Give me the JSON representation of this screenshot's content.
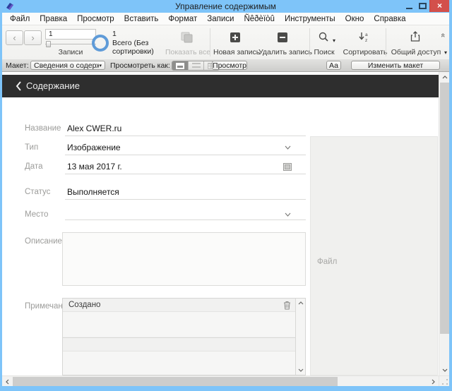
{
  "window": {
    "title": "Управление содержимым"
  },
  "titlebar_controls": {
    "close_glyph": "×"
  },
  "menubar": {
    "items": [
      "Файл",
      "Правка",
      "Просмотр",
      "Вставить",
      "Формат",
      "Записи",
      "Ñêðèïòû",
      "Инструменты",
      "Окно",
      "Справка"
    ]
  },
  "toolbar": {
    "nav_back_glyph": "‹",
    "nav_forward_glyph": "›",
    "records_value": "1",
    "records_label": "Записи",
    "found_count": "1",
    "found_line1": "Всего (Без",
    "found_line2": "сортировки)",
    "show_all_label": "Показать все",
    "new_record_label": "Новая запись",
    "delete_record_label": "Удалить запись",
    "find_label": "Поиск",
    "sort_label": "Сортировать",
    "share_label": "Общий доступ"
  },
  "layoutbar": {
    "layout_label": "Макет:",
    "layout_value": "Сведения о содержимом",
    "view_as_label": "Просмотреть как:",
    "preview_label": "Просмотр",
    "format_label": "Аа",
    "edit_layout_label": "Изменить макет"
  },
  "content": {
    "header_title": "Содержание",
    "form": {
      "title_label": "Название",
      "title_value": "Alex CWER.ru",
      "type_label": "Тип",
      "type_value": "Изображение",
      "date_label": "Дата",
      "date_value": "13 мая 2017 г.",
      "status_label": "Статус",
      "status_value": "Выполняется",
      "place_label": "Место",
      "place_value": "",
      "description_label": "Описание",
      "description_value": "",
      "notes_label": "Примечания",
      "notes_rows": [
        {
          "text": "Создано"
        },
        {
          "text": ""
        }
      ],
      "file_label": "Файл"
    }
  },
  "icons": {
    "dropdown_glyph": "▾",
    "collapse_glyph": "«"
  },
  "colors": {
    "titlebar_blue": "#7ec4f9",
    "accent_blue": "#5f9bd8",
    "header_dark": "#2e2e2e",
    "close_red": "#d3504b"
  }
}
